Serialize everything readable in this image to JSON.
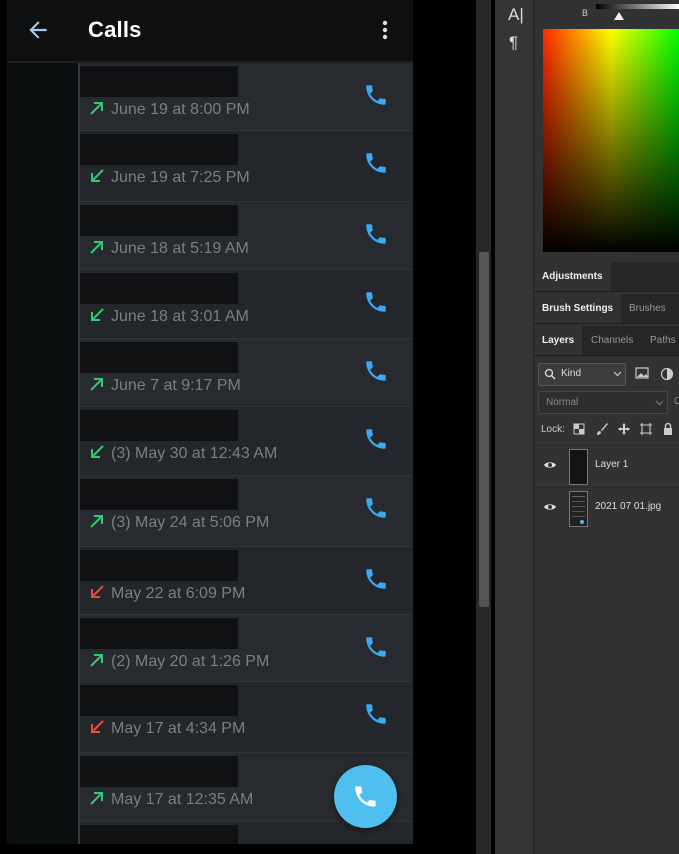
{
  "app_bar": {
    "title": "Calls",
    "back_icon": "arrow-left-icon",
    "menu_icon": "more-vertical-icon"
  },
  "call_log": [
    {
      "time": "June 19 at 8:00 PM",
      "direction": "outgoing",
      "missed": false
    },
    {
      "time": "June 19 at 7:25 PM",
      "direction": "incoming",
      "missed": false
    },
    {
      "time": "June 18 at 5:19 AM",
      "direction": "outgoing",
      "missed": false
    },
    {
      "time": "June 18 at 3:01 AM",
      "direction": "incoming",
      "missed": false
    },
    {
      "time": "June 7 at 9:17 PM",
      "direction": "outgoing",
      "missed": false
    },
    {
      "time": "(3) May 30 at 12:43 AM",
      "direction": "incoming",
      "missed": false
    },
    {
      "time": "(3) May 24 at 5:06 PM",
      "direction": "outgoing",
      "missed": false
    },
    {
      "time": "May 22 at 6:09 PM",
      "direction": "incoming",
      "missed": true
    },
    {
      "time": "(2) May 20 at 1:26 PM",
      "direction": "outgoing",
      "missed": false
    },
    {
      "time": "May 17 at 4:34 PM",
      "direction": "incoming",
      "missed": true
    },
    {
      "time": "May 17 at 12:35 AM",
      "direction": "outgoing",
      "missed": false
    },
    {
      "time": "",
      "direction": "none",
      "missed": false
    }
  ],
  "colors": {
    "outgoing_arrow": "#2ecc71",
    "incoming_arrow": "#2ecc71",
    "missed_arrow": "#e74c3c",
    "call_icon": "#3aa9f0",
    "fab": "#4fbff0"
  },
  "photoshop": {
    "tools": {
      "type_icon": "A|",
      "paragraph_icon": "¶"
    },
    "color_picker": {
      "channel_label": "B"
    },
    "tabs": {
      "adjustments": "Adjustments",
      "brush_settings": "Brush Settings",
      "brushes": "Brushes",
      "layers": "Layers",
      "channels": "Channels",
      "paths": "Paths"
    },
    "filter_kind": "Kind",
    "blend_mode": "Normal",
    "opacity_label": "O",
    "lock_label": "Lock:",
    "layers": [
      {
        "name": "Layer 1",
        "visible": true
      },
      {
        "name": "2021 07 01.jpg",
        "visible": true
      }
    ]
  }
}
